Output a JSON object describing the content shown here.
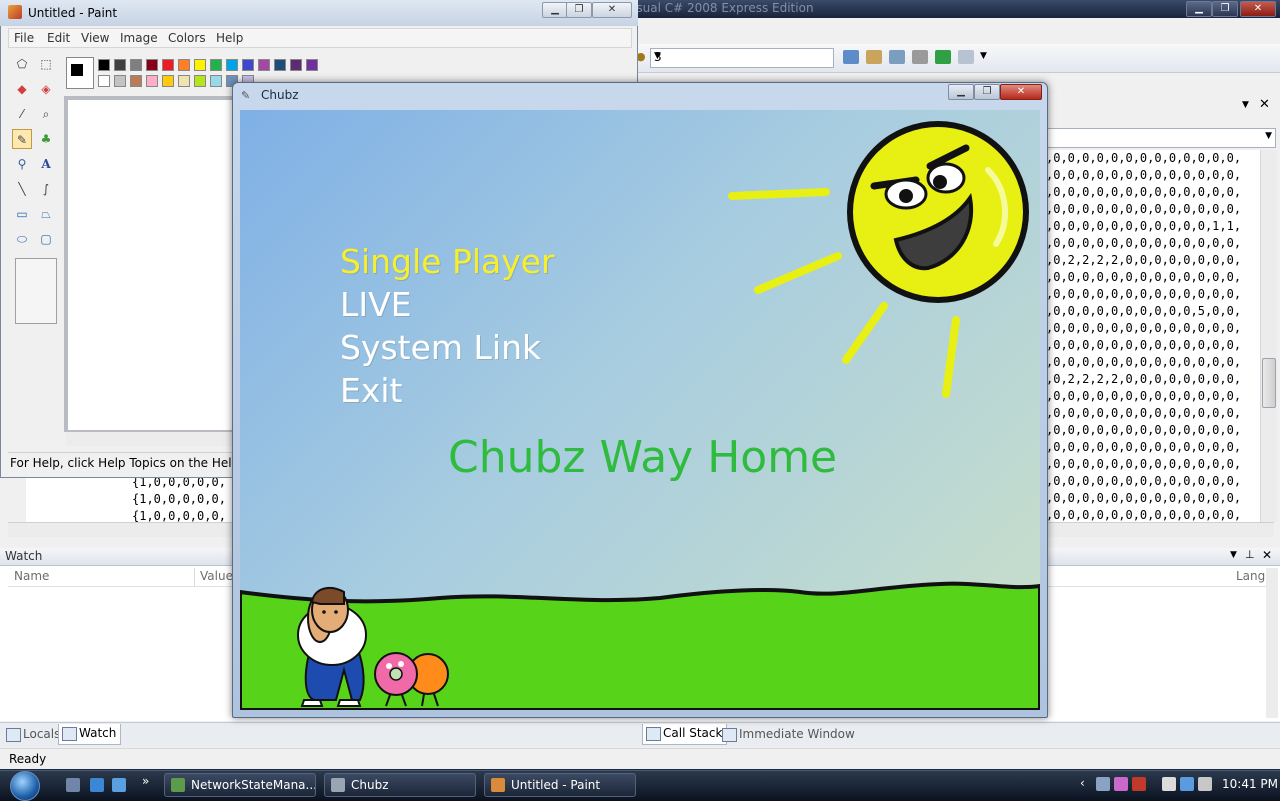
{
  "vs": {
    "title": "(Debugging) [Windows Running] - Microsoft Visual C# 2008 Express Edition",
    "toolbar_combo_value": "3",
    "editor_lines": [
      ",0,0,0,0,0,0,0,0,0,0,0,0,0,",
      ",0,0,0,0,0,0,0,0,0,0,0,0,0,",
      ",0,0,0,0,0,0,0,0,0,0,0,0,0,",
      ",0,0,0,0,0,0,0,0,0,0,0,0,0,",
      ",0,0,0,0,0,0,0,0,0,0,0,1,1,",
      ",0,0,0,0,0,0,0,0,0,0,0,0,0,",
      ",0,2,2,2,2,0,0,0,0,0,0,0,0,",
      ",0,0,0,0,0,0,0,0,0,0,0,0,0,",
      ",0,0,0,0,0,0,0,0,0,0,0,0,0,",
      ",0,0,0,0,0,0,0,0,0,0,5,0,0,",
      ",0,0,0,0,0,0,0,0,0,0,0,0,0,",
      ",0,0,0,0,0,0,0,0,0,0,0,0,0,",
      ",0,0,0,0,0,0,0,0,0,0,0,0,0,",
      ",0,2,2,2,2,0,0,0,0,0,0,0,0,",
      ",0,0,0,0,0,0,0,0,0,0,0,0,0,",
      ",0,0,0,0,0,0,0,0,0,0,0,0,0,",
      ",0,0,0,0,0,0,0,0,0,0,0,0,0,",
      ",0,0,0,0,0,0,0,0,0,0,0,0,0,",
      ",0,0,0,0,0,0,0,0,0,0,0,0,0,",
      ",0,0,0,0,0,0,0,0,0,0,0,0,0,",
      ",0,0,0,0,0,0,0,0,0,0,0,0,0,",
      ",0,0,0,0,0,0,0,0,0,0,0,0,0,"
    ],
    "left_code_lines": [
      "{1,0,0,0,0,0,",
      "{1,0,0,0,0,0,",
      "{1,0,0,0,0,0,"
    ],
    "watch_title": "Watch",
    "watch_col_name": "Name",
    "watch_col_value": "Value",
    "watch_col_lang": "Lang",
    "tab_locals": "Locals",
    "tab_watch": "Watch",
    "tab_callstack": "Call Stack",
    "tab_immediate": "Immediate Window",
    "status": "Ready"
  },
  "paint": {
    "title": "Untitled - Paint",
    "menu": [
      "File",
      "Edit",
      "View",
      "Image",
      "Colors",
      "Help"
    ],
    "status": "For Help, click Help Topics on the Help Menu.",
    "palette_top": [
      "#000000",
      "#3f3f3f",
      "#7f7f7f",
      "#880015",
      "#ed1c24",
      "#ff7f27",
      "#fff200",
      "#22b14c",
      "#00a2e8",
      "#3f48cc",
      "#a349a4",
      "#1f4e79",
      "#5b2c6f",
      "#7030a0"
    ],
    "palette_bottom": [
      "#ffffff",
      "#c3c3c3",
      "#b97a57",
      "#ffaec9",
      "#ffc90e",
      "#efe4b0",
      "#b5e61d",
      "#99d9ea",
      "#7092be",
      "#c8bfe7"
    ]
  },
  "chubz": {
    "window_title": "Chubz",
    "menu": {
      "single_player": "Single Player",
      "live": "LIVE",
      "system_link": "System Link",
      "exit": "Exit"
    },
    "game_title": "Chubz Way Home",
    "colors": {
      "selected": "#f7ef2a",
      "normal": "#ffffff",
      "title": "#2fbb3e",
      "grass": "#57d41a",
      "sun": "#e7f012"
    }
  },
  "taskbar": {
    "tasks": [
      "NetworkStateMana...",
      "Chubz",
      "Untitled - Paint"
    ],
    "clock": "10:41 PM"
  }
}
